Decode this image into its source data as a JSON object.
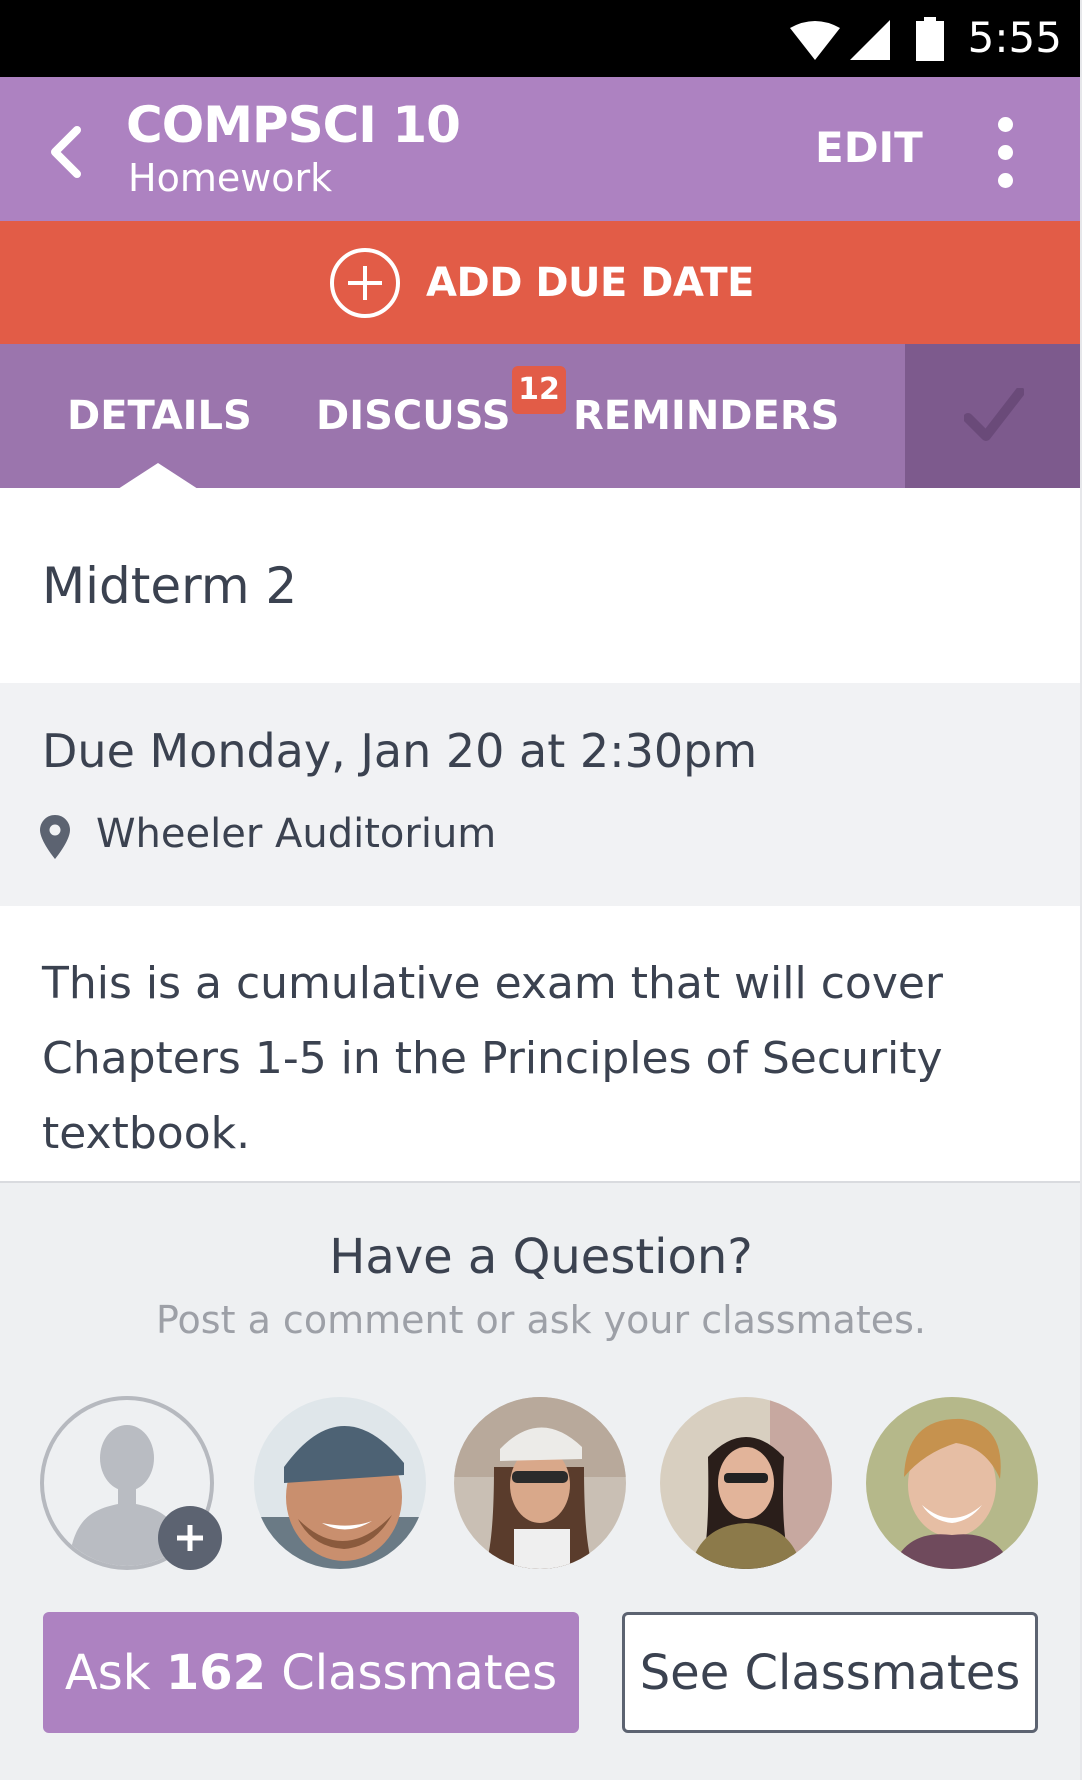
{
  "status_bar": {
    "time": "5:55"
  },
  "app_bar": {
    "course": "COMPSCI 10",
    "subtitle": "Homework",
    "edit_label": "EDIT"
  },
  "due_bar": {
    "label": "ADD DUE DATE"
  },
  "tabs": {
    "items": [
      {
        "label": "DETAILS",
        "active": true
      },
      {
        "label": "DISCUSS",
        "badge": "12"
      },
      {
        "label": "REMINDERS"
      }
    ]
  },
  "assignment": {
    "title": "Midterm 2",
    "due": "Due Monday, Jan 20 at 2:30pm",
    "location": "Wheeler Auditorium",
    "description": "This is a cumulative exam that will cover Chapters 1-5 in the Principles of Security textbook."
  },
  "question": {
    "title": "Have a Question?",
    "subtitle": "Post a comment or ask your classmates.",
    "ask_prefix": "Ask ",
    "ask_count": "162",
    "ask_suffix": " Classmates",
    "see_label": "See Classmates"
  },
  "colors": {
    "accent": "#ad82c1",
    "tab_bar": "#9b75ad",
    "due_bar": "#e25c47",
    "done": "#7d5a8d",
    "text": "#3b4250"
  },
  "icons": {
    "back": "chevron-left-icon",
    "more": "more-vertical-icon",
    "add": "plus-circle-icon",
    "done": "checkmark-icon",
    "location": "map-pin-icon"
  }
}
